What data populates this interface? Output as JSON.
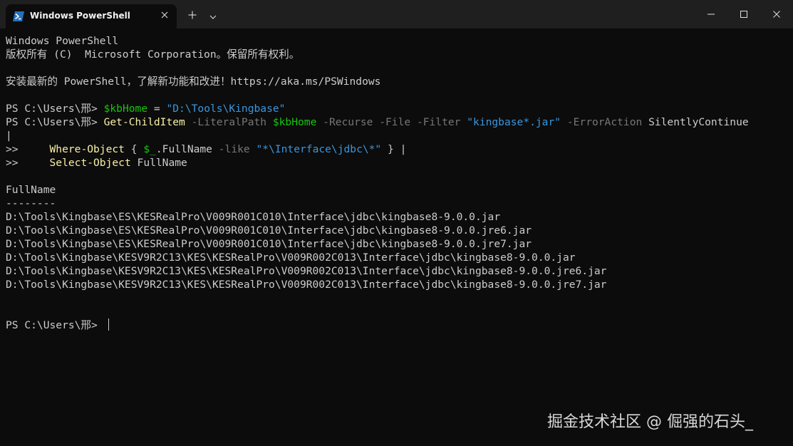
{
  "window": {
    "tab_title": "Windows PowerShell",
    "icons": {
      "tab": "powershell-icon",
      "tab_close": "close-icon",
      "new_tab": "plus-icon",
      "dropdown": "chevron-down-icon",
      "minimize": "minimize-icon",
      "maximize": "maximize-icon",
      "close": "close-icon"
    }
  },
  "colors": {
    "background": "#0c0c0c",
    "titlebar": "#1f1f1f",
    "text": "#cccccc",
    "variable": "#16c60c",
    "string": "#3a96dd",
    "command": "#f9f1a5",
    "parameter": "#767676"
  },
  "terminal": {
    "header_line1": "Windows PowerShell",
    "header_line2": "版权所有 (C)  Microsoft Corporation。保留所有权利。",
    "update_notice": "安装最新的 PowerShell，了解新功能和改进！https://aka.ms/PSWindows",
    "prompt": "PS C:\\Users\\邢> ",
    "cmd1": {
      "var": "$kbHome",
      "eq": " = ",
      "str": "\"D:\\Tools\\Kingbase\""
    },
    "cmd2": {
      "command": "Get-ChildItem",
      "p1": " -LiteralPath ",
      "var": "$kbHome",
      "p2": " -Recurse -File -Filter ",
      "str": "\"kingbase*.jar\"",
      "p3": " -ErrorAction ",
      "arg": "SilentlyContinue",
      "pipe": "|"
    },
    "cmd3": {
      "cont": ">>     ",
      "command": "Where-Object",
      "t1": " { ",
      "var": "$_",
      "t2": ".FullName ",
      "op": "-like",
      "t3": " ",
      "str": "\"*\\Interface\\jdbc\\*\"",
      "t4": " } |"
    },
    "cmd4": {
      "cont": ">>     ",
      "command": "Select-Object",
      "arg": " FullName"
    },
    "output_header": "FullName",
    "output_separator": "--------",
    "results": [
      "D:\\Tools\\Kingbase\\ES\\KESRealPro\\V009R001C010\\Interface\\jdbc\\kingbase8-9.0.0.jar",
      "D:\\Tools\\Kingbase\\ES\\KESRealPro\\V009R001C010\\Interface\\jdbc\\kingbase8-9.0.0.jre6.jar",
      "D:\\Tools\\Kingbase\\ES\\KESRealPro\\V009R001C010\\Interface\\jdbc\\kingbase8-9.0.0.jre7.jar",
      "D:\\Tools\\Kingbase\\KESV9R2C13\\KES\\KESRealPro\\V009R002C013\\Interface\\jdbc\\kingbase8-9.0.0.jar",
      "D:\\Tools\\Kingbase\\KESV9R2C13\\KES\\KESRealPro\\V009R002C013\\Interface\\jdbc\\kingbase8-9.0.0.jre6.jar",
      "D:\\Tools\\Kingbase\\KESV9R2C13\\KES\\KESRealPro\\V009R002C013\\Interface\\jdbc\\kingbase8-9.0.0.jre7.jar"
    ]
  },
  "watermark": "掘金技术社区 @ 倔强的石头_"
}
